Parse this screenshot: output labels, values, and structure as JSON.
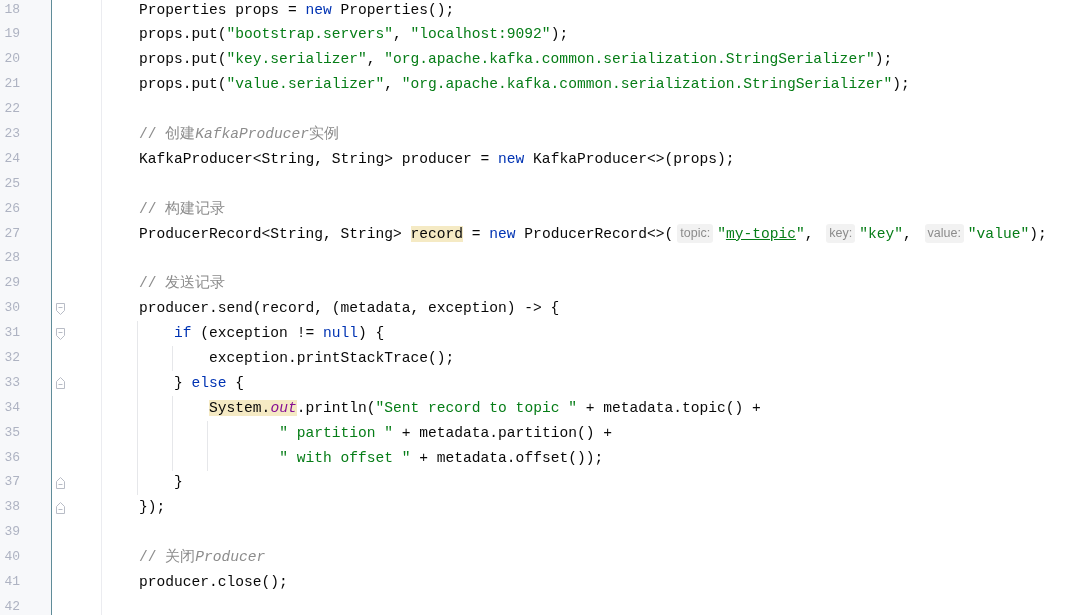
{
  "editor": {
    "lines": [
      {
        "number": "18",
        "kind": "plain",
        "code": [
          {
            "kind": "plain",
            "text": "Properties props = "
          },
          {
            "kind": "keyword",
            "text": "new"
          },
          {
            "kind": "plain",
            "text": " Properties();"
          }
        ]
      },
      {
        "number": "19",
        "kind": "plain",
        "code": [
          {
            "kind": "plain",
            "text": "props.put("
          },
          {
            "kind": "string",
            "text": "\"bootstrap.servers\""
          },
          {
            "kind": "plain",
            "text": ", "
          },
          {
            "kind": "string",
            "text": "\"localhost:9092\""
          },
          {
            "kind": "plain",
            "text": ");"
          }
        ]
      },
      {
        "number": "20",
        "kind": "plain",
        "code": [
          {
            "kind": "plain",
            "text": "props.put("
          },
          {
            "kind": "string",
            "text": "\"key.serializer\""
          },
          {
            "kind": "plain",
            "text": ", "
          },
          {
            "kind": "string",
            "text": "\"org.apache.kafka.common.serialization.StringSerializer\""
          },
          {
            "kind": "plain",
            "text": ");"
          }
        ]
      },
      {
        "number": "21",
        "kind": "plain",
        "code": [
          {
            "kind": "plain",
            "text": "props.put("
          },
          {
            "kind": "string",
            "text": "\"value.serializer\""
          },
          {
            "kind": "plain",
            "text": ", "
          },
          {
            "kind": "string",
            "text": "\"org.apache.kafka.common.serialization.StringSerializer\""
          },
          {
            "kind": "plain",
            "text": ");"
          }
        ]
      },
      {
        "number": "22",
        "kind": "plain"
      },
      {
        "number": "23",
        "kind": "plain",
        "code": [
          {
            "kind": "comment",
            "text": "// 创建"
          },
          {
            "kind": "comment-italic",
            "text": "KafkaProducer"
          },
          {
            "kind": "comment",
            "text": "实例"
          }
        ]
      },
      {
        "number": "24",
        "kind": "plain",
        "code": [
          {
            "kind": "plain",
            "text": "KafkaProducer<String, String> producer = "
          },
          {
            "kind": "keyword",
            "text": "new"
          },
          {
            "kind": "plain",
            "text": " KafkaProducer<>(props);"
          }
        ]
      },
      {
        "number": "25",
        "kind": "plain"
      },
      {
        "number": "26",
        "kind": "plain",
        "code": [
          {
            "kind": "comment",
            "text": "// 构建记录"
          }
        ]
      },
      {
        "number": "27",
        "kind": "plain",
        "code": [
          {
            "kind": "plain",
            "text": "ProducerRecord<String, String> "
          },
          {
            "kind": "highlight",
            "text": "record"
          },
          {
            "kind": "plain",
            "text": " = "
          },
          {
            "kind": "keyword",
            "text": "new"
          },
          {
            "kind": "plain",
            "text": " ProducerRecord<>("
          },
          {
            "kind": "hint",
            "text": "topic:"
          },
          {
            "kind": "string",
            "text": "\""
          },
          {
            "kind": "link",
            "text": "my-topic"
          },
          {
            "kind": "string",
            "text": "\""
          },
          {
            "kind": "plain",
            "text": ", "
          },
          {
            "kind": "hint",
            "text": "key:"
          },
          {
            "kind": "string",
            "text": "\"key\""
          },
          {
            "kind": "plain",
            "text": ", "
          },
          {
            "kind": "hint",
            "text": "value:"
          },
          {
            "kind": "string",
            "text": "\"value\""
          },
          {
            "kind": "plain",
            "text": ");"
          }
        ]
      },
      {
        "number": "28",
        "kind": "plain"
      },
      {
        "number": "29",
        "kind": "plain",
        "code": [
          {
            "kind": "comment",
            "text": "// 发送记录"
          }
        ]
      },
      {
        "number": "30",
        "kind": "fold-start",
        "code": [
          {
            "kind": "plain",
            "text": "producer.send(record, (metadata, exception) -> {"
          }
        ],
        "children": [
          {
            "number": "31",
            "kind": "fold-start",
            "code": [
              {
                "kind": "keyword",
                "text": "if"
              },
              {
                "kind": "plain",
                "text": " (exception != "
              },
              {
                "kind": "keyword",
                "text": "null"
              },
              {
                "kind": "plain",
                "text": ") {"
              }
            ],
            "children": [
              {
                "number": "32",
                "kind": "plain",
                "code": [
                  {
                    "kind": "plain",
                    "text": "exception.printStackTrace();"
                  }
                ]
              }
            ]
          },
          {
            "number": "33",
            "kind": "fold-end",
            "code": [
              {
                "kind": "plain",
                "text": "} "
              },
              {
                "kind": "keyword",
                "text": "else"
              },
              {
                "kind": "plain",
                "text": " {"
              }
            ],
            "children": [
              {
                "number": "34",
                "kind": "plain",
                "continued": true,
                "code": [
                  {
                    "kind": "highlight",
                    "text": "System."
                  },
                  {
                    "kind": "highlight-field",
                    "text": "out"
                  },
                  {
                    "kind": "plain",
                    "text": ".println("
                  },
                  {
                    "kind": "string",
                    "text": "\"Sent record to topic \""
                  },
                  {
                    "kind": "plain",
                    "text": " + metadata.topic() +"
                  }
                ],
                "children": [
                  {
                    "number": "35",
                    "kind": "plain",
                    "code": [
                      {
                        "kind": "string",
                        "text": "\" partition \""
                      },
                      {
                        "kind": "plain",
                        "text": " + metadata.partition() +"
                      }
                    ]
                  },
                  {
                    "number": "36",
                    "kind": "plain",
                    "code": [
                      {
                        "kind": "string",
                        "text": "\" with offset \""
                      },
                      {
                        "kind": "plain",
                        "text": " + metadata.offset());"
                      }
                    ]
                  }
                ]
              }
            ]
          },
          {
            "number": "37",
            "kind": "fold-end",
            "code": [
              {
                "kind": "plain",
                "text": "}"
              }
            ]
          }
        ]
      },
      {
        "number": "38",
        "kind": "fold-end",
        "code": [
          {
            "kind": "plain",
            "text": "});"
          }
        ]
      },
      {
        "number": "39",
        "kind": "plain"
      },
      {
        "number": "40",
        "kind": "plain",
        "code": [
          {
            "kind": "comment",
            "text": "// 关闭"
          },
          {
            "kind": "comment-italic",
            "text": "Producer"
          }
        ]
      },
      {
        "number": "41",
        "kind": "plain",
        "code": [
          {
            "kind": "plain",
            "text": "producer.close();"
          }
        ]
      },
      {
        "number": "42",
        "kind": "plain"
      }
    ]
  }
}
